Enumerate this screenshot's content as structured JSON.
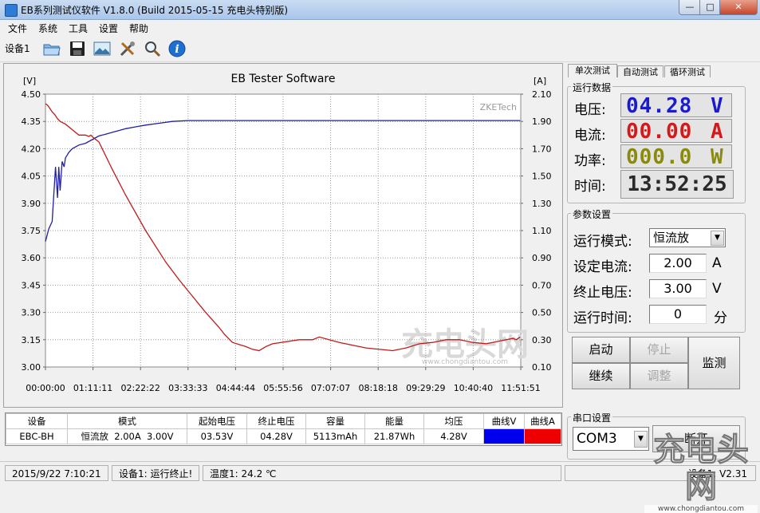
{
  "window": {
    "title": "EB系列测试仪软件 V1.8.0 (Build 2015-05-15 充电头特别版)"
  },
  "menu": [
    "文件",
    "系统",
    "工具",
    "设置",
    "帮助"
  ],
  "toolbar": {
    "device_tab": "设备1",
    "icons": [
      "open-folder-icon",
      "save-icon",
      "picture-icon",
      "tools-icon",
      "magnifier-icon",
      "info-icon"
    ]
  },
  "chart_data": {
    "type": "line",
    "title": "EB Tester Software",
    "watermark": "ZKETech",
    "y_left_unit": "[V]",
    "y_right_unit": "[A]",
    "y_left_ticks": [
      "4.50",
      "4.35",
      "4.20",
      "4.05",
      "3.90",
      "3.75",
      "3.60",
      "3.45",
      "3.30",
      "3.15",
      "3.00"
    ],
    "y_right_ticks": [
      "2.10",
      "1.90",
      "1.70",
      "1.50",
      "1.30",
      "1.10",
      "0.90",
      "0.70",
      "0.50",
      "0.30",
      "0.10"
    ],
    "x_ticks": [
      "00:00:00",
      "01:11:11",
      "02:22:22",
      "03:33:33",
      "04:44:44",
      "05:55:56",
      "07:07:07",
      "08:18:18",
      "09:29:29",
      "10:40:40",
      "11:51:51"
    ],
    "ylim_left": [
      3.0,
      4.5
    ],
    "ylim_right": [
      0.1,
      2.1
    ],
    "xlim_minutes": [
      0,
      711.85
    ],
    "series": [
      {
        "name": "曲线V",
        "axis": "left",
        "color": "#1f1fa8",
        "x": [
          0,
          5,
          10,
          15,
          18,
          20,
          22,
          25,
          28,
          30,
          35,
          40,
          50,
          60,
          70,
          80,
          90,
          100,
          110,
          120,
          135,
          150,
          170,
          190,
          213,
          240,
          280,
          320,
          360,
          400,
          450,
          500,
          550,
          600,
          650,
          700,
          711
        ],
        "y": [
          3.69,
          3.76,
          3.8,
          4.1,
          3.93,
          4.1,
          3.97,
          4.13,
          4.1,
          4.15,
          4.18,
          4.2,
          4.22,
          4.23,
          4.25,
          4.27,
          4.28,
          4.29,
          4.3,
          4.31,
          4.32,
          4.33,
          4.34,
          4.35,
          4.355,
          4.355,
          4.355,
          4.355,
          4.355,
          4.355,
          4.355,
          4.355,
          4.355,
          4.355,
          4.355,
          4.355,
          4.355
        ]
      },
      {
        "name": "曲线A",
        "axis": "right",
        "color": "#c01a1a",
        "x": [
          0,
          3,
          6,
          10,
          14,
          18,
          22,
          26,
          30,
          40,
          50,
          60,
          65,
          68,
          72,
          80,
          90,
          100,
          120,
          150,
          180,
          200,
          220,
          240,
          260,
          268,
          280,
          300,
          310,
          320,
          330,
          340,
          380,
          400,
          410,
          440,
          480,
          520,
          540,
          560,
          580,
          600,
          620,
          640,
          660,
          680,
          700,
          705,
          711
        ],
        "y": [
          2.03,
          2.02,
          2.0,
          1.97,
          1.95,
          1.92,
          1.9,
          1.89,
          1.88,
          1.84,
          1.8,
          1.8,
          1.79,
          1.8,
          1.78,
          1.75,
          1.65,
          1.55,
          1.36,
          1.1,
          0.87,
          0.74,
          0.62,
          0.5,
          0.39,
          0.34,
          0.28,
          0.25,
          0.23,
          0.22,
          0.25,
          0.27,
          0.3,
          0.3,
          0.32,
          0.28,
          0.24,
          0.22,
          0.24,
          0.27,
          0.28,
          0.3,
          0.3,
          0.28,
          0.27,
          0.29,
          0.31,
          0.3,
          0.32
        ]
      }
    ],
    "grid": true,
    "background_watermark": "充电头网",
    "background_watermark_sub": "www.chongdiantou.com"
  },
  "right_panel": {
    "tabs": [
      "单次测试",
      "自动测试",
      "循环测试"
    ],
    "run_data": {
      "title": "运行数据",
      "voltage_label": "电压:",
      "voltage_value": "04.28",
      "voltage_unit": "V",
      "current_label": "电流:",
      "current_value": "00.00",
      "current_unit": "A",
      "power_label": "功率:",
      "power_value": "000.0",
      "power_unit": "W",
      "time_label": "时间:",
      "time_value": "13:52:25"
    },
    "params": {
      "title": "参数设置",
      "mode_label": "运行模式:",
      "mode_value": "恒流放",
      "current_label": "设定电流:",
      "current_value": "2.00",
      "current_unit": "A",
      "cutoff_label": "终止电压:",
      "cutoff_value": "3.00",
      "cutoff_unit": "V",
      "time_label": "运行时间:",
      "time_value": "0",
      "time_unit": "分"
    },
    "buttons": {
      "start": "启动",
      "stop": "停止",
      "continue": "继续",
      "adjust": "调整",
      "monitor": "监测"
    },
    "serial": {
      "title": "串口设置",
      "port": "COM3",
      "disconnect": "断开"
    }
  },
  "table": {
    "headers": [
      "设备",
      "模式",
      "起始电压",
      "终止电压",
      "容量",
      "能量",
      "均压",
      "曲线V",
      "曲线A"
    ],
    "row": [
      "EBC-BH",
      "恒流放  2.00A  3.00V",
      "03.53V",
      "04.28V",
      "5113mAh",
      "21.87Wh",
      "4.28V",
      "",
      ""
    ],
    "colors": {
      "curveV": "#0000ee",
      "curveA": "#ee0000"
    }
  },
  "statusbar": {
    "datetime": "2015/9/22 7:10:21",
    "device_status": "设备1: 运行终止!",
    "temperature": "温度1: 24.2 ℃",
    "device_version": "设备1: V2.31"
  },
  "watermark_logo": {
    "text": "充电头网",
    "url": "www.chongdiantou.com"
  }
}
